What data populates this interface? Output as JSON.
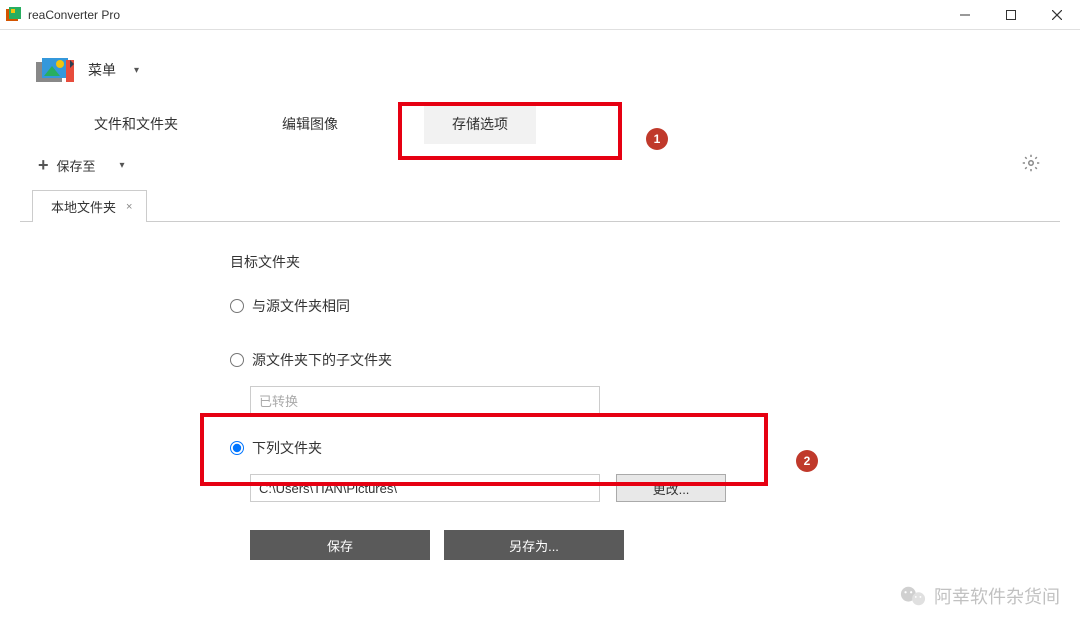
{
  "titlebar": {
    "title": "reaConverter Pro"
  },
  "menu": {
    "label": "菜单"
  },
  "tabs": {
    "files": "文件和文件夹",
    "edit": "编辑图像",
    "storage": "存储选项"
  },
  "toolbar": {
    "save_to": "保存至"
  },
  "subtabs": {
    "local": "本地文件夹"
  },
  "panel": {
    "target_label": "目标文件夹",
    "radio_same": "与源文件夹相同",
    "radio_subfolder": "源文件夹下的子文件夹",
    "subfolder_placeholder": "已转换",
    "radio_following": "下列文件夹",
    "path_value": "C:\\Users\\TIAN\\Pictures\\",
    "change_btn": "更改...",
    "save_btn": "保存",
    "save_as_btn": "另存为..."
  },
  "badges": {
    "one": "1",
    "two": "2"
  },
  "watermark": {
    "text": "阿幸软件杂货间"
  }
}
